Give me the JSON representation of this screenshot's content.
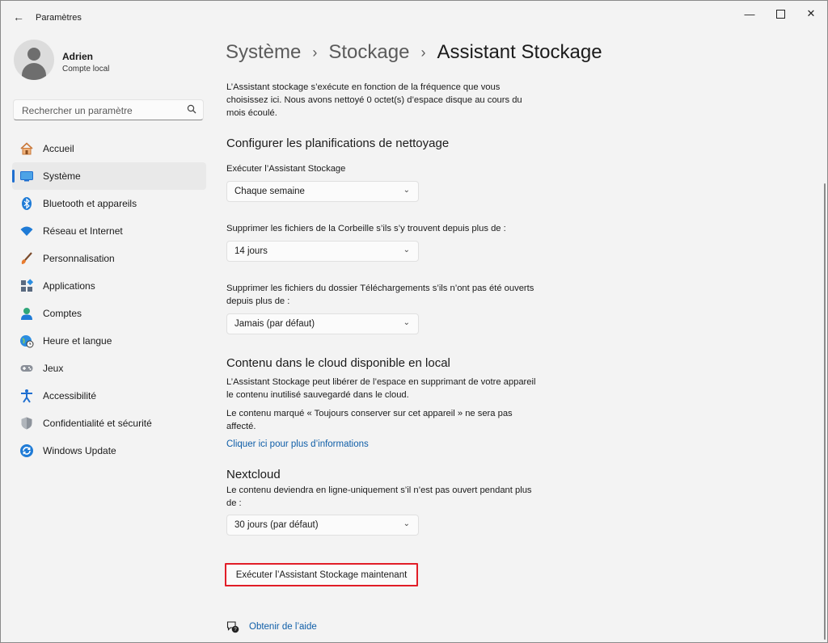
{
  "window": {
    "title": "Paramètres",
    "back_icon": "arrow-left-icon",
    "minimize_icon": "minimize-icon",
    "maximize_icon": "maximize-icon",
    "close_icon": "close-icon"
  },
  "user": {
    "name": "Adrien",
    "account_type": "Compte local"
  },
  "search": {
    "placeholder": "Rechercher un paramètre",
    "icon": "search-icon"
  },
  "sidebar": {
    "items": [
      {
        "label": "Accueil",
        "icon": "home-icon",
        "active": false
      },
      {
        "label": "Système",
        "icon": "system-icon",
        "active": true
      },
      {
        "label": "Bluetooth et appareils",
        "icon": "bluetooth-icon",
        "active": false
      },
      {
        "label": "Réseau et Internet",
        "icon": "wifi-icon",
        "active": false
      },
      {
        "label": "Personnalisation",
        "icon": "brush-icon",
        "active": false
      },
      {
        "label": "Applications",
        "icon": "apps-icon",
        "active": false
      },
      {
        "label": "Comptes",
        "icon": "account-icon",
        "active": false
      },
      {
        "label": "Heure et langue",
        "icon": "globe-clock-icon",
        "active": false
      },
      {
        "label": "Jeux",
        "icon": "gamepad-icon",
        "active": false
      },
      {
        "label": "Accessibilité",
        "icon": "accessibility-icon",
        "active": false
      },
      {
        "label": "Confidentialité et sécurité",
        "icon": "shield-icon",
        "active": false
      },
      {
        "label": "Windows Update",
        "icon": "update-icon",
        "active": false
      }
    ]
  },
  "breadcrumb": {
    "level1": "Système",
    "level2": "Stockage",
    "current": "Assistant Stockage"
  },
  "main": {
    "intro": "L’Assistant stockage s’exécute en fonction de la fréquence que vous choisissez ici. Nous avons nettoyé 0 octet(s) d’espace disque au cours du mois écoulé.",
    "cleanup_heading": "Configurer les planifications de nettoyage",
    "run_label": "Exécuter l’Assistant Stockage",
    "run_value": "Chaque semaine",
    "recycle_label": "Supprimer les fichiers de la Corbeille s’ils s’y trouvent depuis plus de :",
    "recycle_value": "14 jours",
    "downloads_label": "Supprimer les fichiers du dossier Téléchargements s’ils n’ont pas été ouverts depuis plus de :",
    "downloads_value": "Jamais (par défaut)",
    "cloud_heading": "Contenu dans le cloud disponible en local",
    "cloud_desc1": "L’Assistant Stockage peut libérer de l’espace en supprimant de votre appareil le contenu inutilisé sauvegardé dans le cloud.",
    "cloud_desc2": "Le contenu marqué « Toujours conserver sur cet appareil » ne sera pas affecté.",
    "cloud_link": "Cliquer ici pour plus d’informations",
    "nextcloud_heading": "Nextcloud",
    "nextcloud_desc": "Le contenu deviendra en ligne-uniquement s’il n’est pas ouvert pendant plus de :",
    "nextcloud_value": "30 jours (par défaut)",
    "run_now_button": "Exécuter l’Assistant Stockage maintenant",
    "help_link": "Obtenir de l’aide",
    "help_icon": "help-chat-icon",
    "highlight_color": "#e11d27",
    "accent_color": "#1f6fd0",
    "link_color": "#0f5ea8"
  }
}
